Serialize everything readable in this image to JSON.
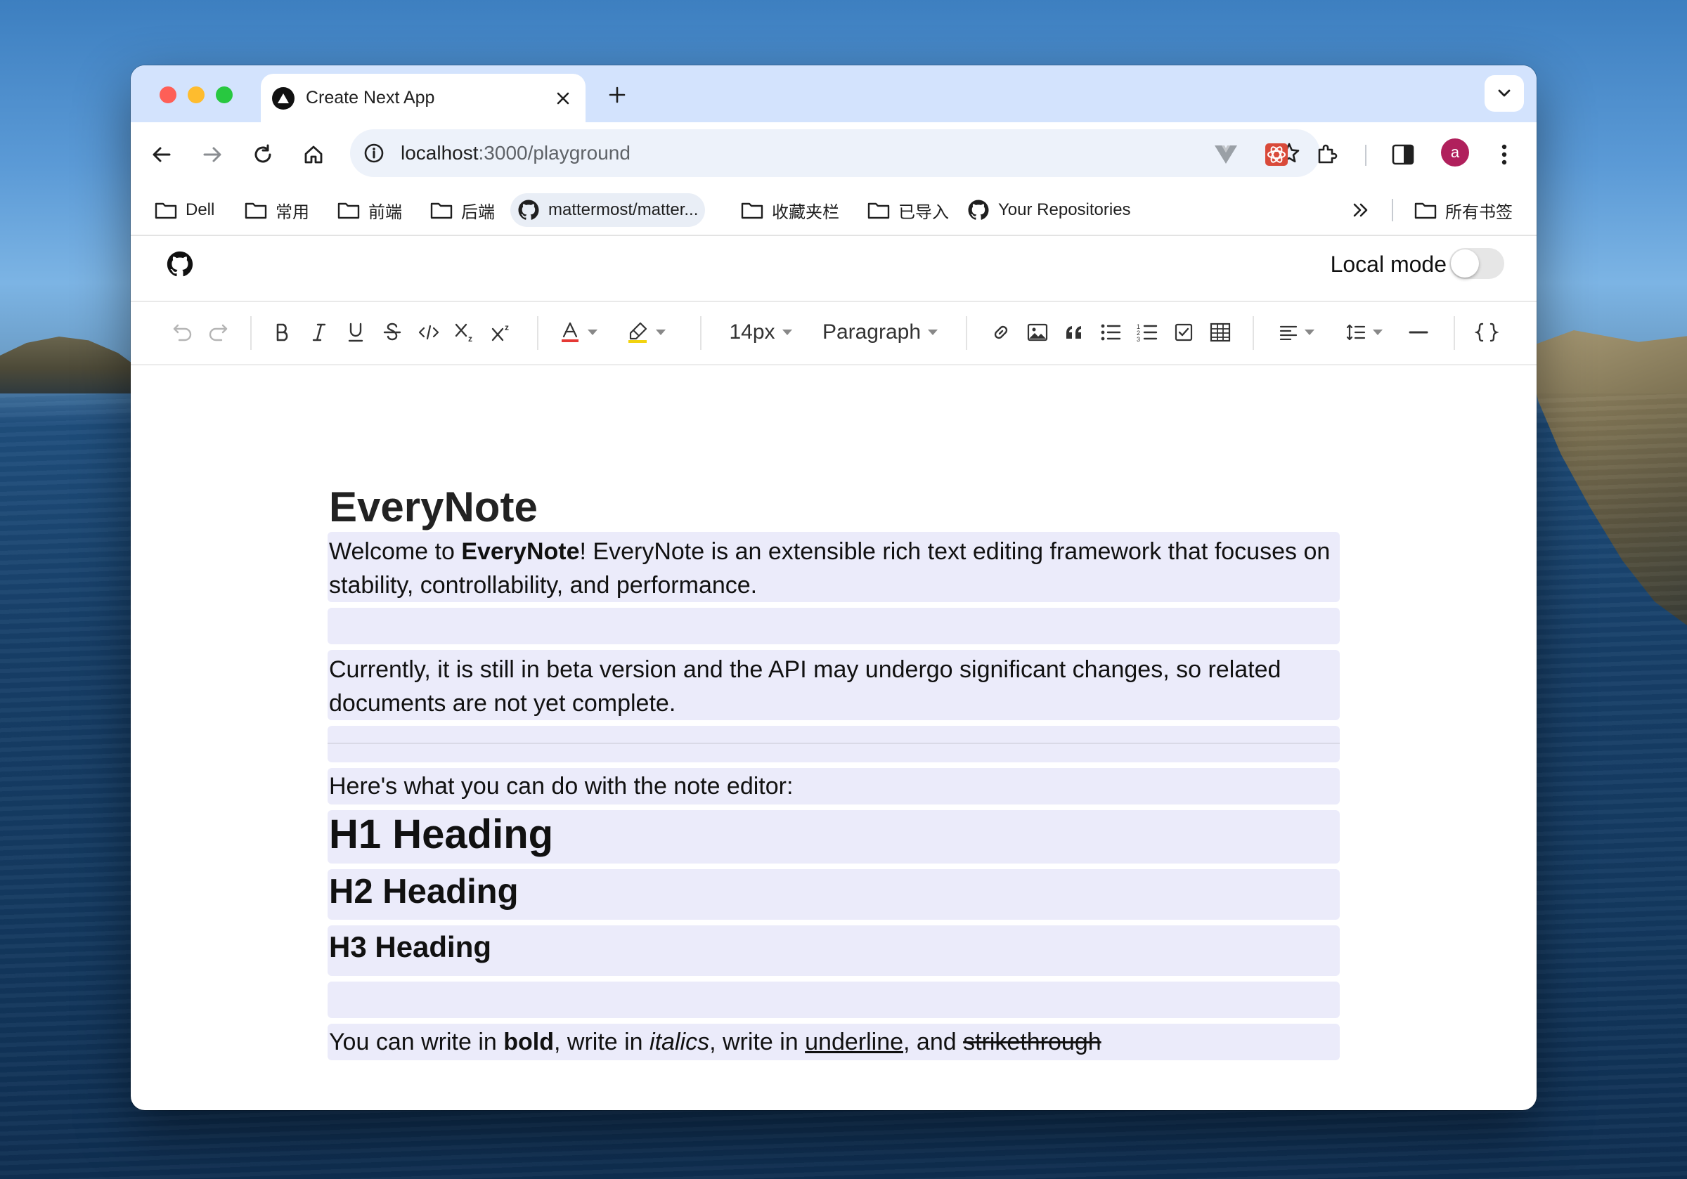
{
  "browser": {
    "tab": {
      "title": "Create Next App"
    },
    "address": {
      "host": "localhost",
      "path": ":3000/playground"
    },
    "avatar_letter": "a",
    "bookmarks": [
      "Dell",
      "常用",
      "前端",
      "后端",
      "mattermost/matter...",
      "收藏夹栏",
      "已导入",
      "Your Repositories"
    ],
    "all_bookmarks": "所有书签"
  },
  "page": {
    "local_mode_label": "Local mode",
    "local_mode_on": false
  },
  "editor_toolbar": {
    "font_size": "14px",
    "block_type": "Paragraph",
    "text_color": "#e53935",
    "highlight_color": "#f2d30f"
  },
  "document": {
    "title": "EveryNote",
    "intro": {
      "prefix": "Welcome to ",
      "bold": "EveryNote",
      "suffix": "! EveryNote is an extensible rich text editing framework that focuses on stability, controllability, and performance."
    },
    "beta_note": "Currently, it is still in beta version and the API may undergo significant changes, so related documents are not yet complete.",
    "lead": "Here's what you can do with the note editor:",
    "h1": "H1 Heading",
    "h2": "H2 Heading",
    "h3": "H3 Heading",
    "formatting": {
      "p1": "You can write in ",
      "bold": "bold",
      "p2": ", write in ",
      "italic": "italics",
      "p3": ", write in ",
      "underline": "underline",
      "p4": ", and ",
      "strike": "strikethrough"
    }
  }
}
